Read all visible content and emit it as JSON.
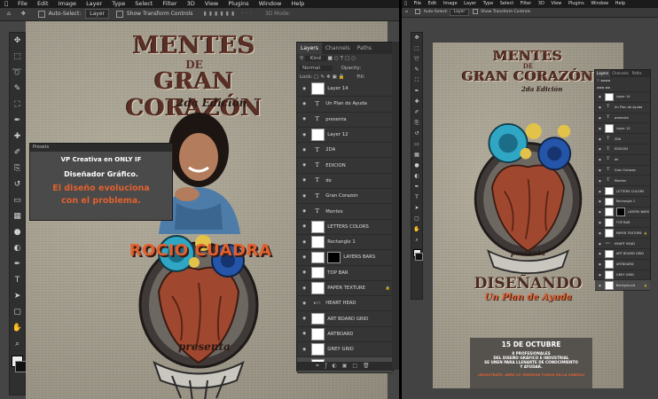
{
  "left": {
    "menu": [
      "File",
      "Edit",
      "Image",
      "Layer",
      "Type",
      "Select",
      "Filter",
      "3D",
      "View",
      "Plugins",
      "Window",
      "Help"
    ],
    "options": {
      "auto_select_label": "Auto-Select:",
      "auto_select_value": "Layer",
      "transform_label": "Show Transform Controls",
      "mode_3d": "3D Mode:"
    },
    "poster": {
      "line1": "MENTES",
      "line2": "DE",
      "line3": "GRAN CORAZÓN",
      "edition": "2da Edición",
      "name": "ROCIO CUADRA",
      "presenta": "presenta"
    },
    "popup": {
      "tab": "Presets",
      "line1": "VP Creativa en ONLY IF",
      "line2": "Diseñador Gráfico.",
      "line3": "El diseño evoluciona",
      "line4": "con el problema."
    },
    "layers_panel": {
      "tabs": [
        "Layers",
        "Channels",
        "Paths"
      ],
      "kind": "Kind",
      "mode": "Normal",
      "opacity": "Opacity:",
      "lock": "Lock:",
      "fill": "Fill:",
      "layers": [
        {
          "name": "Layer 14",
          "type": "img"
        },
        {
          "name": "Un Plan de Ayuda",
          "type": "text"
        },
        {
          "name": "presenta",
          "type": "text"
        },
        {
          "name": "Layer 12",
          "type": "img"
        },
        {
          "name": "2DA",
          "type": "text"
        },
        {
          "name": "EDICIÓN",
          "type": "text"
        },
        {
          "name": "de",
          "type": "text"
        },
        {
          "name": "Gran Corazon",
          "type": "text"
        },
        {
          "name": "Mentes",
          "type": "text"
        },
        {
          "name": "LETTERS COLORS",
          "type": "img"
        },
        {
          "name": "Rectangle 1",
          "type": "img"
        },
        {
          "name": "LAYERS BARS",
          "type": "mask"
        },
        {
          "name": "TOP BAR",
          "type": "img"
        },
        {
          "name": "PAPER TEXTURE",
          "type": "img",
          "locked": true
        },
        {
          "name": "HEART HEAD",
          "type": "folder"
        },
        {
          "name": "ART BOARD GRID",
          "type": "img"
        },
        {
          "name": "ARTBOARD",
          "type": "img"
        },
        {
          "name": "GREY GRID",
          "type": "img"
        },
        {
          "name": "Background",
          "type": "img",
          "selected": true,
          "locked": true
        }
      ]
    }
  },
  "right": {
    "menu": [
      "File",
      "Edit",
      "Image",
      "Layer",
      "Type",
      "Select",
      "Filter",
      "3D",
      "View",
      "Plugins",
      "Window",
      "Help"
    ],
    "options": {
      "auto_select_label": "Auto-Select:",
      "auto_select_value": "Layer",
      "transform_label": "Show Transform Controls"
    },
    "poster": {
      "line1": "MENTES",
      "line2": "DE",
      "line3": "GRAN CORAZÓN",
      "edition": "2da Edición",
      "presenta": "presenta",
      "disenando": "DISEÑANDO",
      "plan": "Un Plan de Ayuda",
      "date": "15 DE OCTUBRE",
      "info1": "8 PROFESIONALES",
      "info2": "DEL DISEÑO GRÁFICO E INDUSTRIAL",
      "info3": "SE UNEN PARA LLENARTE DE CONOCIMIENTO",
      "info4": "Y AYUDAR.",
      "footer": "¡REGISTRATE, ABRE LO TENEMOS TODOS EN LA CABEZA!"
    },
    "layers_panel": {
      "tabs": [
        "Layers",
        "Channels",
        "Paths"
      ],
      "layers": [
        {
          "name": "Layer 14",
          "type": "img"
        },
        {
          "name": "Un Plan de Ayuda",
          "type": "text"
        },
        {
          "name": "presenta",
          "type": "text"
        },
        {
          "name": "Layer 12",
          "type": "img"
        },
        {
          "name": "2DA",
          "type": "text"
        },
        {
          "name": "EDICIÓN",
          "type": "text"
        },
        {
          "name": "de",
          "type": "text"
        },
        {
          "name": "Gran Corazon",
          "type": "text"
        },
        {
          "name": "Mentes",
          "type": "text"
        },
        {
          "name": "LETTERS COLORS",
          "type": "img"
        },
        {
          "name": "Rectangle 1",
          "type": "img"
        },
        {
          "name": "LAYERS BARS",
          "type": "mask"
        },
        {
          "name": "TOP BAR",
          "type": "img"
        },
        {
          "name": "PAPER TEXTURE",
          "type": "img",
          "locked": true
        },
        {
          "name": "HEART HEAD",
          "type": "folder"
        },
        {
          "name": "ART BOARD GRID",
          "type": "img"
        },
        {
          "name": "ARTBOARD",
          "type": "img"
        },
        {
          "name": "GREY GRID",
          "type": "img"
        },
        {
          "name": "Background",
          "type": "img",
          "selected": true,
          "locked": true
        }
      ]
    }
  },
  "colors": {
    "accent_orange": "#e0612f",
    "title_brown": "#5a2e25",
    "panel": "#353535",
    "menubar": "#1b1b1b",
    "flower_blue": "#2fa6c4",
    "heart_red": "#a0482f"
  },
  "tool_icons": [
    "move-icon",
    "marquee-icon",
    "lasso-icon",
    "quick-select-icon",
    "crop-icon",
    "eyedropper-icon",
    "healing-icon",
    "brush-icon",
    "clone-icon",
    "history-brush-icon",
    "eraser-icon",
    "gradient-icon",
    "blur-icon",
    "dodge-icon",
    "pen-icon",
    "type-icon",
    "path-select-icon",
    "shape-icon",
    "hand-icon",
    "zoom-icon"
  ]
}
